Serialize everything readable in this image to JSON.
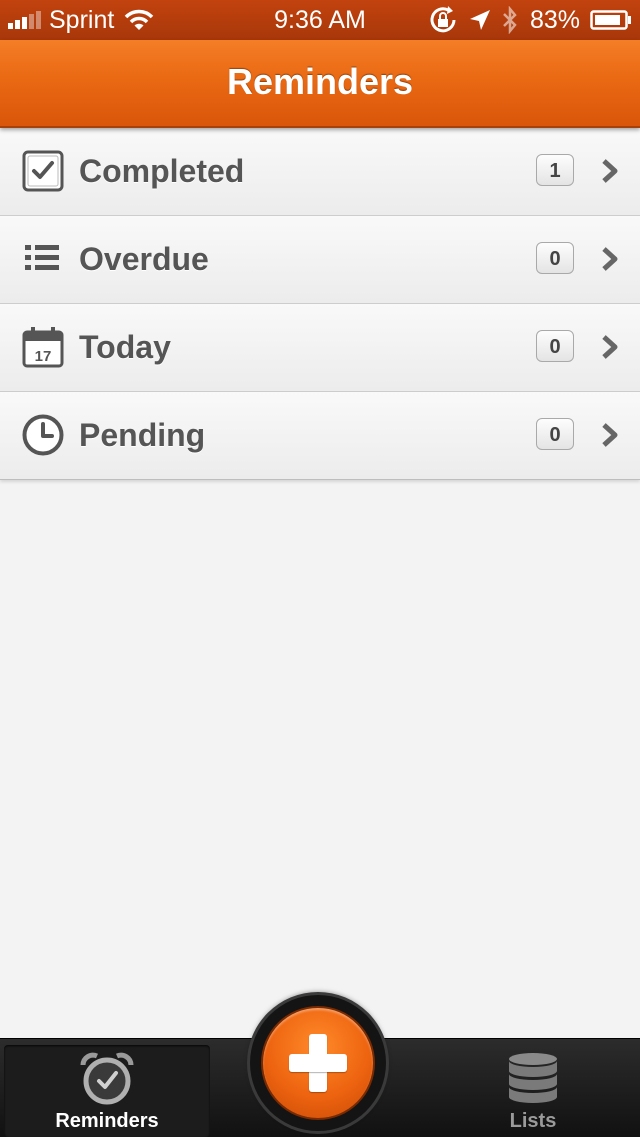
{
  "status_bar": {
    "carrier": "Sprint",
    "time": "9:36 AM",
    "battery": "83%"
  },
  "nav": {
    "title": "Reminders"
  },
  "rows": [
    {
      "label": "Completed",
      "count": "1",
      "icon": "checkbox-icon"
    },
    {
      "label": "Overdue",
      "count": "0",
      "icon": "list-icon"
    },
    {
      "label": "Today",
      "count": "0",
      "icon": "calendar-icon",
      "calendar_day": "17"
    },
    {
      "label": "Pending",
      "count": "0",
      "icon": "clock-icon"
    }
  ],
  "tab_bar": {
    "tabs": [
      {
        "label": "Reminders",
        "icon": "alarm-clock-icon",
        "selected": true
      },
      {
        "label": "Lists",
        "icon": "database-stack-icon",
        "selected": false
      }
    ],
    "add_icon": "plus-icon"
  },
  "colors": {
    "accent": "#ea6913",
    "status_bar": "#b63d0c",
    "row_text": "#555555"
  }
}
